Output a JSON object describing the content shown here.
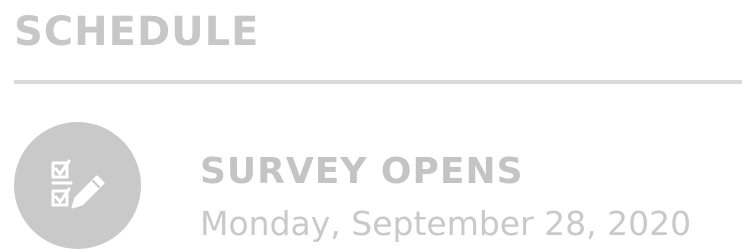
{
  "schedule": {
    "title": "SCHEDULE",
    "events": [
      {
        "title": "SURVEY OPENS",
        "date": "Monday, September 28, 2020",
        "icon": "survey-checklist-pencil-icon"
      }
    ]
  },
  "colors": {
    "text": "#c4c4c4",
    "divider": "#d9d9d9",
    "icon_background": "#c9c9c9",
    "icon_foreground": "#ffffff"
  }
}
